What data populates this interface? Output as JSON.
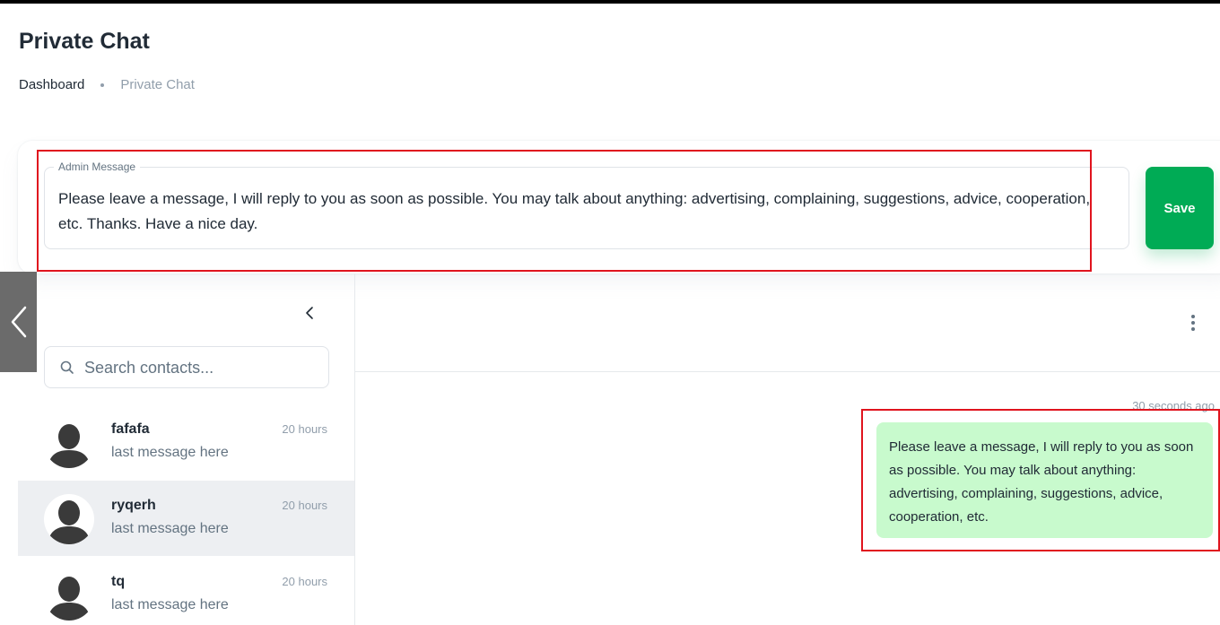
{
  "page": {
    "title": "Private Chat"
  },
  "breadcrumb": {
    "items": [
      "Dashboard",
      "Private Chat"
    ]
  },
  "admin_message": {
    "label": "Admin Message",
    "value": "Please leave a message, I will reply to you as soon as possible. You may talk about anything: advertising, complaining, suggestions, advice, cooperation, etc. Thanks. Have a nice day.",
    "save_label": "Save"
  },
  "search": {
    "placeholder": "Search contacts..."
  },
  "contacts": [
    {
      "name": "fafafa",
      "last": "last message here",
      "time": "20 hours"
    },
    {
      "name": "ryqerh",
      "last": "last message here",
      "time": "20 hours"
    },
    {
      "name": "tq",
      "last": "last message here",
      "time": "20 hours"
    }
  ],
  "chat": {
    "message_time": "30 seconds ago",
    "message_text": "Please leave a message, I will reply to you as soon as possible. You may talk about anything: advertising, complaining, suggestions, advice, cooperation, etc."
  },
  "colors": {
    "accent": "#00ab55",
    "bubble": "#c8facd",
    "highlight": "#e0141e",
    "active_row": "#edeff2"
  },
  "icons": [
    "chevron-left-icon",
    "collapse-icon",
    "search-icon",
    "more-vertical-icon",
    "avatar-placeholder-icon"
  ]
}
